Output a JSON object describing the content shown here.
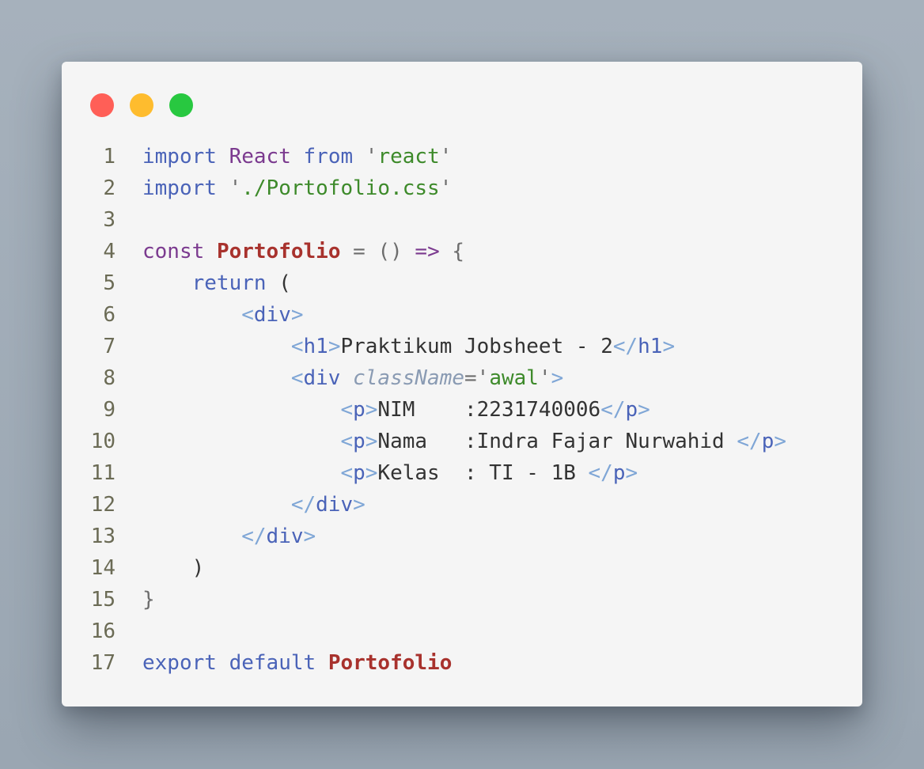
{
  "window": {
    "controls": [
      {
        "name": "close",
        "color": "#ff5f57"
      },
      {
        "name": "minimize",
        "color": "#febc2e"
      },
      {
        "name": "maximize",
        "color": "#28c840"
      }
    ]
  },
  "code": {
    "lines": [
      {
        "n": "1",
        "tokens": [
          [
            "keyword",
            "import"
          ],
          [
            "plain",
            " "
          ],
          [
            "module",
            "React"
          ],
          [
            "plain",
            " "
          ],
          [
            "keyword",
            "from"
          ],
          [
            "plain",
            " "
          ],
          [
            "punct",
            "'"
          ],
          [
            "string",
            "react"
          ],
          [
            "punct",
            "'"
          ]
        ]
      },
      {
        "n": "2",
        "tokens": [
          [
            "keyword",
            "import"
          ],
          [
            "plain",
            " "
          ],
          [
            "punct",
            "'"
          ],
          [
            "string",
            "./Portofolio.css"
          ],
          [
            "punct",
            "'"
          ]
        ]
      },
      {
        "n": "3",
        "tokens": []
      },
      {
        "n": "4",
        "tokens": [
          [
            "module",
            "const"
          ],
          [
            "plain",
            " "
          ],
          [
            "func",
            "Portofolio"
          ],
          [
            "plain",
            " "
          ],
          [
            "eq",
            "="
          ],
          [
            "plain",
            " "
          ],
          [
            "punct",
            "()"
          ],
          [
            "plain",
            " "
          ],
          [
            "arrow",
            "=>"
          ],
          [
            "plain",
            " "
          ],
          [
            "punct",
            "{"
          ]
        ]
      },
      {
        "n": "5",
        "tokens": [
          [
            "plain",
            "    "
          ],
          [
            "keyword",
            "return"
          ],
          [
            "plain",
            " "
          ],
          [
            "text",
            "("
          ]
        ]
      },
      {
        "n": "6",
        "tokens": [
          [
            "plain",
            "        "
          ],
          [
            "bracket",
            "<"
          ],
          [
            "tag",
            "div"
          ],
          [
            "bracket",
            ">"
          ]
        ]
      },
      {
        "n": "7",
        "tokens": [
          [
            "plain",
            "            "
          ],
          [
            "bracket",
            "<"
          ],
          [
            "tag",
            "h1"
          ],
          [
            "bracket",
            ">"
          ],
          [
            "text",
            "Praktikum Jobsheet - 2"
          ],
          [
            "bracket",
            "</"
          ],
          [
            "tag",
            "h1"
          ],
          [
            "bracket",
            ">"
          ]
        ]
      },
      {
        "n": "8",
        "tokens": [
          [
            "plain",
            "            "
          ],
          [
            "bracket",
            "<"
          ],
          [
            "tag",
            "div"
          ],
          [
            "plain",
            " "
          ],
          [
            "attr",
            "className"
          ],
          [
            "eq",
            "="
          ],
          [
            "punct",
            "'"
          ],
          [
            "string",
            "awal"
          ],
          [
            "punct",
            "'"
          ],
          [
            "bracket",
            ">"
          ]
        ]
      },
      {
        "n": "9",
        "tokens": [
          [
            "plain",
            "                "
          ],
          [
            "bracket",
            "<"
          ],
          [
            "tag",
            "p"
          ],
          [
            "bracket",
            ">"
          ],
          [
            "text",
            "NIM    :2231740006"
          ],
          [
            "bracket",
            "</"
          ],
          [
            "tag",
            "p"
          ],
          [
            "bracket",
            ">"
          ]
        ]
      },
      {
        "n": "10",
        "tokens": [
          [
            "plain",
            "                "
          ],
          [
            "bracket",
            "<"
          ],
          [
            "tag",
            "p"
          ],
          [
            "bracket",
            ">"
          ],
          [
            "text",
            "Nama   :Indra Fajar Nurwahid "
          ],
          [
            "bracket",
            "</"
          ],
          [
            "tag",
            "p"
          ],
          [
            "bracket",
            ">"
          ]
        ]
      },
      {
        "n": "11",
        "tokens": [
          [
            "plain",
            "                "
          ],
          [
            "bracket",
            "<"
          ],
          [
            "tag",
            "p"
          ],
          [
            "bracket",
            ">"
          ],
          [
            "text",
            "Kelas  : TI - 1B "
          ],
          [
            "bracket",
            "</"
          ],
          [
            "tag",
            "p"
          ],
          [
            "bracket",
            ">"
          ]
        ]
      },
      {
        "n": "12",
        "tokens": [
          [
            "plain",
            "            "
          ],
          [
            "bracket",
            "</"
          ],
          [
            "tag",
            "div"
          ],
          [
            "bracket",
            ">"
          ]
        ]
      },
      {
        "n": "13",
        "tokens": [
          [
            "plain",
            "        "
          ],
          [
            "bracket",
            "</"
          ],
          [
            "tag",
            "div"
          ],
          [
            "bracket",
            ">"
          ]
        ]
      },
      {
        "n": "14",
        "tokens": [
          [
            "plain",
            "    "
          ],
          [
            "text",
            ")"
          ]
        ]
      },
      {
        "n": "15",
        "tokens": [
          [
            "punct",
            "}"
          ]
        ]
      },
      {
        "n": "16",
        "tokens": []
      },
      {
        "n": "17",
        "tokens": [
          [
            "keyword",
            "export"
          ],
          [
            "plain",
            " "
          ],
          [
            "keyword",
            "default"
          ],
          [
            "plain",
            " "
          ],
          [
            "func",
            "Portofolio"
          ]
        ]
      }
    ]
  }
}
